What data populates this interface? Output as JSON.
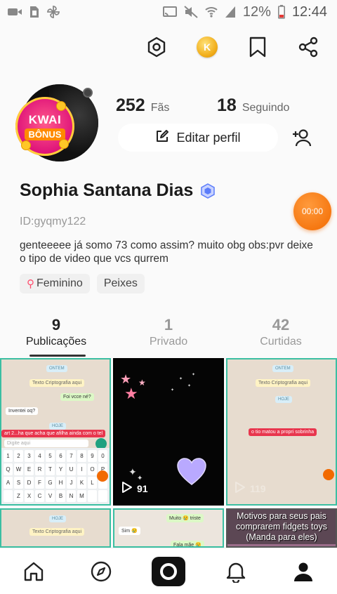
{
  "status_bar": {
    "battery_percent": "12%",
    "time": "12:44"
  },
  "profile": {
    "avatar_badge_line1": "KWAI",
    "avatar_badge_line2": "BÔNUS",
    "fans_count": "252",
    "fans_label": "Fãs",
    "following_count": "18",
    "following_label": "Seguindo",
    "edit_label": "Editar perfil",
    "name": "Sophia Santana Dias",
    "timer": "00:00",
    "user_id": "ID:gyqmy122",
    "bio": "genteeeee já somo 73 como assim? muito obg obs:pvr deixe o tipo de video que vcs qurrem",
    "tags": [
      "Feminino",
      "Peixes"
    ]
  },
  "tabs": [
    {
      "count": "9",
      "label": "Publicações",
      "active": true
    },
    {
      "count": "1",
      "label": "Privado",
      "active": false
    },
    {
      "count": "42",
      "label": "Curtidas",
      "active": false
    }
  ],
  "grid": {
    "cell1": {
      "pill1": "ONTEM",
      "msg1": "Texto Criptografia aqui",
      "msg2": "Foi vcce né?",
      "msg3": "Inventei oq?",
      "pill2": "HOJE",
      "msg4": "art 2...ha que acha que afilha ainda com o tel",
      "input_placeholder": "Digite aqui",
      "keys": [
        "1",
        "2",
        "3",
        "4",
        "5",
        "6",
        "7",
        "8",
        "9",
        "0",
        "Q",
        "W",
        "E",
        "R",
        "T",
        "Y",
        "U",
        "I",
        "O",
        "P",
        "A",
        "S",
        "D",
        "F",
        "G",
        "H",
        "J",
        "K",
        "L",
        "",
        "",
        "Z",
        "X",
        "C",
        "V",
        "B",
        "N",
        "M",
        "",
        ""
      ]
    },
    "cell2": {
      "views": "91"
    },
    "cell3": {
      "pill1": "ONTEM",
      "msg1": "Texto Criptografia aqui",
      "pill2": "HOJE",
      "msg2": "o tio matou a propri sobrinha",
      "views": "119"
    },
    "cell4": {
      "pill": "HOJE",
      "msg": "Texto Criptografia aqui"
    },
    "cell5": {
      "msg1": "Muito 😢 triste",
      "msg2": "Sim 😢",
      "msg3": "Fala mãe 😢"
    },
    "cell6": {
      "caption": "Motivos para seus pais comprarem fidgets toys (Manda para eles)"
    }
  },
  "icons": {
    "status_left": [
      "video-camera-icon",
      "sim-card-icon",
      "pinwheel-icon"
    ],
    "status_right": [
      "cast-icon",
      "mute-icon",
      "wifi-icon",
      "signal-icon",
      "battery-icon"
    ],
    "top_actions": [
      "settings-hex-icon",
      "gold-coin-icon",
      "bookmark-icon",
      "share-icon"
    ],
    "bottom_nav": [
      "home-icon",
      "compass-icon",
      "camera-icon",
      "bell-icon",
      "profile-icon"
    ]
  },
  "colors": {
    "accent_orange": "#f26a00",
    "verified_blue": "#5b7cfa",
    "tag_female": "#ff4d6d",
    "grid_border": "#3bbfa2"
  }
}
